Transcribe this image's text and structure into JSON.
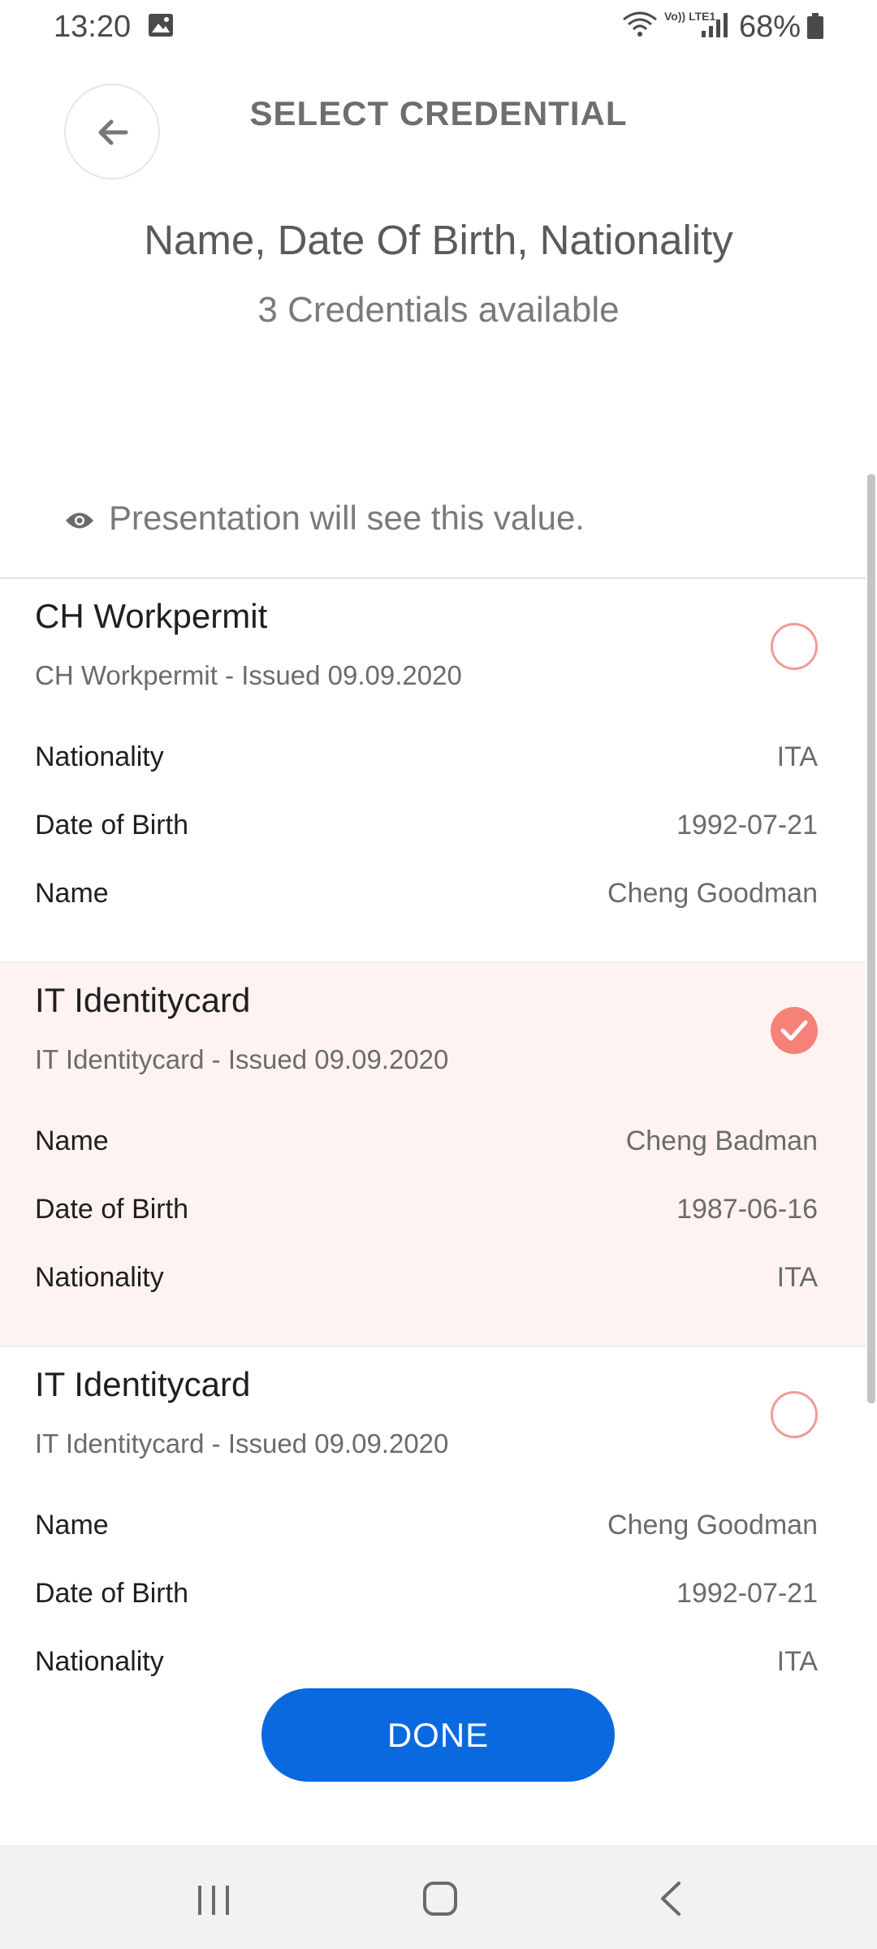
{
  "status_bar": {
    "time": "13:20",
    "volte_label": "Vo)) LTE1",
    "battery": "68%"
  },
  "header": {
    "title": "SELECT CREDENTIAL"
  },
  "request": {
    "attributes": "Name, Date Of Birth, Nationality",
    "available": "3 Credentials available"
  },
  "notice": {
    "text": "Presentation will see this value."
  },
  "credentials": [
    {
      "title": "CH Workpermit",
      "subtitle": "CH Workpermit - Issued 09.09.2020",
      "selected": false,
      "fields": [
        {
          "label": "Nationality",
          "value": "ITA"
        },
        {
          "label": "Date of Birth",
          "value": "1992-07-21"
        },
        {
          "label": "Name",
          "value": "Cheng Goodman"
        }
      ]
    },
    {
      "title": "IT Identitycard",
      "subtitle": "IT Identitycard - Issued 09.09.2020",
      "selected": true,
      "fields": [
        {
          "label": "Name",
          "value": "Cheng Badman"
        },
        {
          "label": "Date of Birth",
          "value": "1987-06-16"
        },
        {
          "label": "Nationality",
          "value": "ITA"
        }
      ]
    },
    {
      "title": "IT Identitycard",
      "subtitle": "IT Identitycard - Issued 09.09.2020",
      "selected": false,
      "fields": [
        {
          "label": "Name",
          "value": "Cheng Goodman"
        },
        {
          "label": "Date of Birth",
          "value": "1992-07-21"
        },
        {
          "label": "Nationality",
          "value": "ITA"
        }
      ]
    }
  ],
  "actions": {
    "done_label": "DONE"
  },
  "colors": {
    "primary": "#0b69df",
    "accent": "#f58179",
    "selected_bg": "#fff3f1"
  },
  "icons": {
    "back": "arrow-left-icon",
    "notice": "eye-icon",
    "selected": "check-icon",
    "nav_recent": "recent-apps-icon",
    "nav_home": "home-icon",
    "nav_back": "chevron-left-icon"
  }
}
